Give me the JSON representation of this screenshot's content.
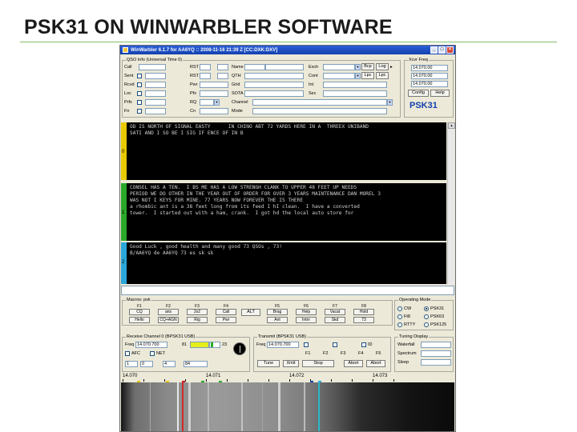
{
  "slide": {
    "title": "PSK31 ON WINWARBLER SOFTWARE"
  },
  "window": {
    "title": "WinWarbler 6.1.7 for AA6YQ :: 2008-11-16  21:39 Z [CC:DXK:DXV]",
    "min": "_",
    "max": "□",
    "close": "×"
  },
  "qso": {
    "group_label": "QSO Info (Universal Time 0)",
    "rows": [
      {
        "l1": "Call",
        "l2": "RST",
        "l3": "Name"
      },
      {
        "l1": "Sent",
        "l2": "RST",
        "l3": "QTH"
      },
      {
        "l1": "Rcvd",
        "l2": "Pwr",
        "l3": "Grid"
      },
      {
        "l1": "Loc",
        "l2": "Pfx",
        "l3": "SOTA"
      },
      {
        "l1": "Prfx",
        "l2": "RQ",
        "l3": "Channel"
      },
      {
        "l1": "Fn",
        "l2": "Cn",
        "l3": "Mode"
      }
    ],
    "rq_value": "RQ",
    "mode_labels": [
      "Exch",
      "Cont",
      "Int",
      "Sec"
    ],
    "log_btn": "Log",
    "log_btn2": "Lpc",
    "dup_btn": "Bcp"
  },
  "xcvr": {
    "group_label": "Xcvr Freq",
    "freqs": [
      "14.070.00",
      "14.070.00",
      "14.070.00"
    ],
    "config": "Config",
    "help": "Help",
    "brand": "PSK31"
  },
  "receive_panes": [
    {
      "num": "0",
      "lines": [
        "OD IS NORTH OF SIGNAL EASTY      IN CHINO ABT 72 YARDS HERE IN A  THREEX UNIBAND",
        "SATI AND I SO BE I SIG IF ENCE OF IN B"
      ]
    },
    {
      "num": "1",
      "lines": [
        "CONSEL HAS A TEN.  I BS ME HAS A LOW STRENGH CLANK TO UPPER 48 FEET UP NEEDS",
        "PERIOD WE DO OTHER IN THE YEAR OUT OF ORDER FOR OVER 3 YEARS MAINTENANCE DAN MOREL 3",
        "WAS NOT I KEYS FOR MINE. 77 YEARS NOW FOREVER THE IS THERE"
      ]
    },
    {
      "num": "",
      "lines": [
        "a rhombic ant is a 38 feet long from its feed I hI clean.  I have a converted",
        "tower.  I started out with a ham, crank.  I got hd the local auto store for"
      ]
    },
    {
      "num": "2",
      "lines": [
        "Good Luck , good health and many good 73 QSOs , 73!",
        "B/AA6YQ de AA6YQ 73 es sk sk"
      ]
    }
  ],
  "macros": {
    "group_label": "Macros: psk",
    "fkeys": [
      "F1",
      "F2",
      "F3",
      "F4",
      "F5",
      "F6",
      "F7",
      "F8"
    ],
    "row1": [
      "CQ",
      "ans",
      "2x2",
      "Call",
      "Brag",
      "Help",
      "Vacat",
      "Hold"
    ],
    "row2": [
      "Hello",
      "CQ+AGN",
      "Rig",
      "Pwr",
      "Ant",
      "Intnr",
      "Skd",
      "73"
    ],
    "alt_btn": "ALT"
  },
  "operating_mode": {
    "group_label": "Operating Mode",
    "options": [
      {
        "l": "CW",
        "r": "PSK31"
      },
      {
        "l": "Ft8",
        "r": "PSK63"
      },
      {
        "l": "RTTY",
        "r": "PSK125"
      }
    ]
  },
  "rx_channel": {
    "group_label": "Receive Channel 0 (BPSK31 USB)",
    "freq_label": "Freq",
    "freq": "14.070.700",
    "level": "81",
    "imd": "23",
    "afc": "AFC",
    "net": "NET",
    "lower_vals": [
      "1",
      "0",
      "4",
      "84"
    ]
  },
  "tx": {
    "group_label": "Transmit (BPSK31 USB)",
    "freq_label": "Freq",
    "freq": "14.070.700",
    "keys": [
      "F1",
      "F2",
      "F3",
      "F4",
      "F5"
    ],
    "btns": [
      "Tune",
      "Xmit",
      "Stop",
      "Abort"
    ],
    "id_label": "ID"
  },
  "tuning": {
    "group_label": "Tuning Display",
    "rows": [
      "Waterfall",
      "Spectrum",
      "Sleep"
    ]
  },
  "ruler": {
    "labels": [
      {
        "text": "14.070",
        "pos": 0
      },
      {
        "text": "14.071",
        "pos": 0.26
      },
      {
        "text": "14.072",
        "pos": 0.51
      },
      {
        "text": "14.073",
        "pos": 0.76
      }
    ]
  },
  "colors": {
    "pane0_strip": "#e8c800",
    "pane1_strip": "#2aa82a",
    "pane2_strip": "#2aa7d8",
    "accent": "#1341b0"
  }
}
